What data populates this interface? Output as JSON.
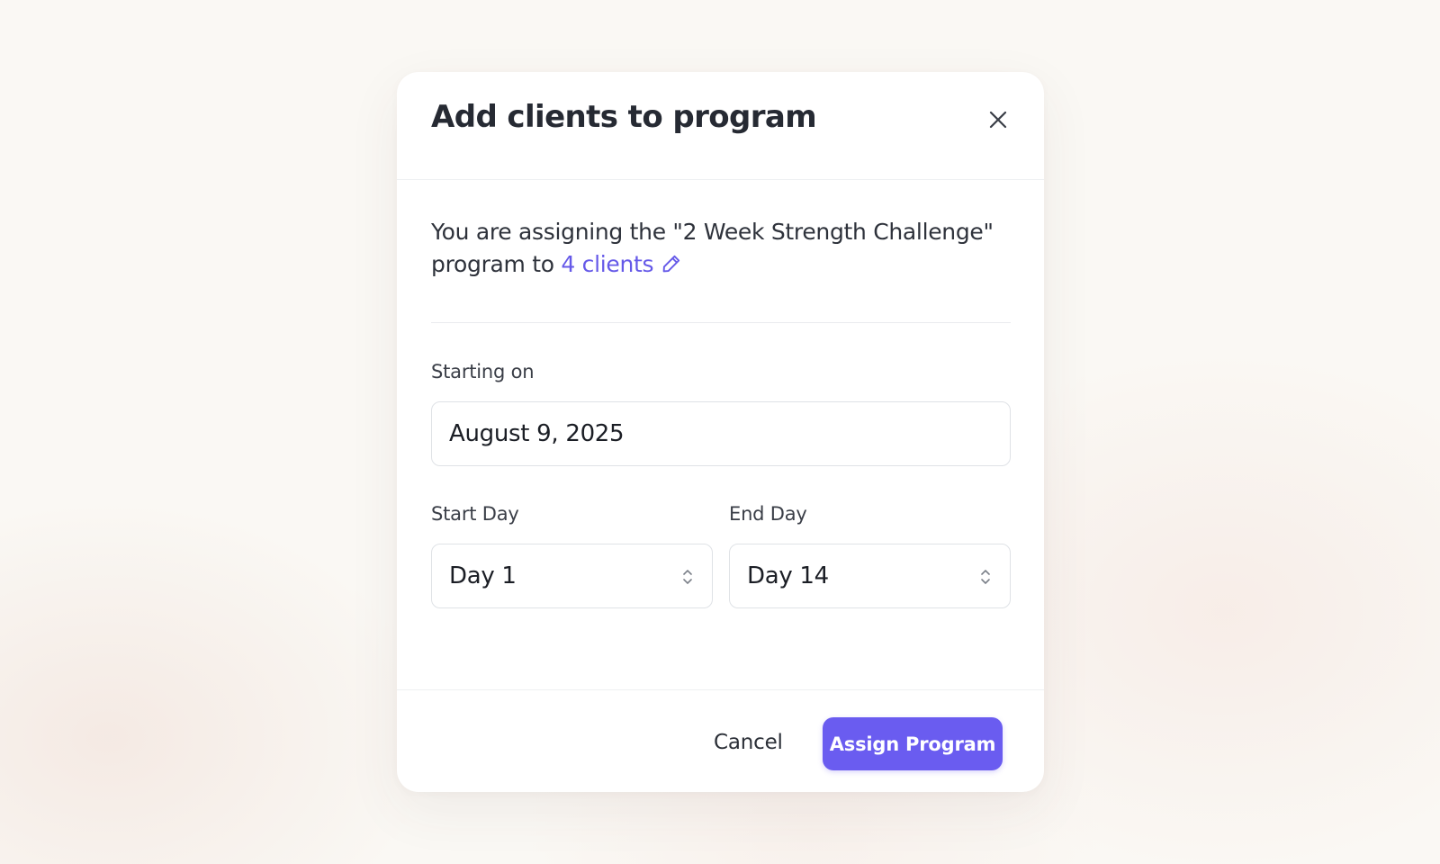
{
  "modal": {
    "title": "Add clients to program",
    "close_label": "close"
  },
  "assignment": {
    "text_prefix": "You are assigning the \"2 Week Strength Challenge\" program to ",
    "clients_link": "4 clients"
  },
  "form": {
    "starting_on_label": "Starting on",
    "starting_on_value": "August 9, 2025",
    "start_day_label": "Start Day",
    "start_day_value": "Day 1",
    "end_day_label": "End Day",
    "end_day_value": "Day 14"
  },
  "footer": {
    "cancel_label": "Cancel",
    "assign_label": "Assign Program"
  },
  "colors": {
    "accent": "#6a5cf0",
    "link": "#6559e8",
    "text": "#262a33",
    "border": "#dfe2e6",
    "background": "#faf8f4"
  },
  "icons": {
    "close": "close-icon",
    "edit": "pencil-icon",
    "select": "chevron-up-down-icon"
  }
}
